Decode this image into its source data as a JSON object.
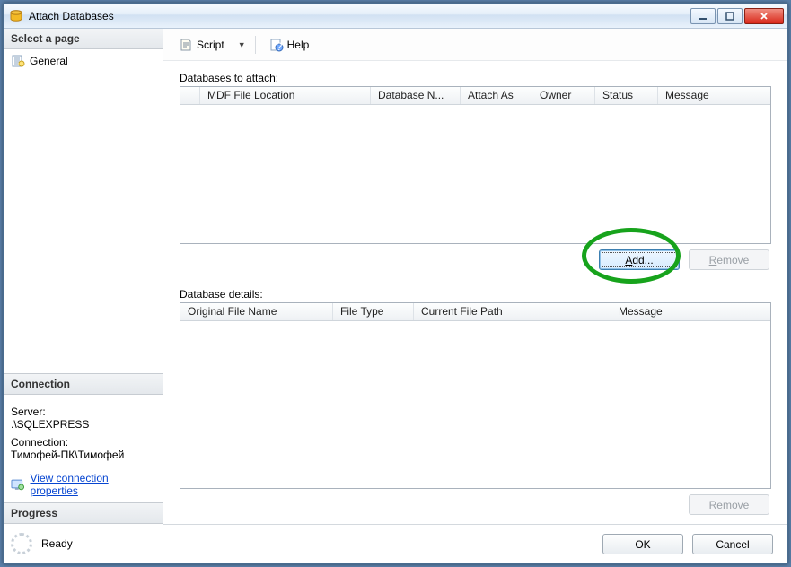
{
  "window": {
    "title": "Attach Databases"
  },
  "win_controls": {
    "minimize": "minimize",
    "maximize": "maximize",
    "close": "close"
  },
  "left": {
    "select_page_header": "Select a page",
    "pages": [
      {
        "label": "General"
      }
    ],
    "connection_header": "Connection",
    "server_label": "Server:",
    "server_value": ".\\SQLEXPRESS",
    "connection_label": "Connection:",
    "connection_value": "Тимофей-ПК\\Тимофей",
    "view_props_link": "View connection properties",
    "progress_header": "Progress",
    "progress_status": "Ready"
  },
  "toolbar": {
    "script_label": "Script",
    "help_label": "Help"
  },
  "attach_grid": {
    "label_html": "Databases to attach:",
    "label_u": "D",
    "label_rest": "atabases to attach:",
    "cols": {
      "mdf": "MDF File Location",
      "dbname": "Database N...",
      "attachas": "Attach As",
      "owner": "Owner",
      "status": "Status",
      "message": "Message"
    }
  },
  "buttons": {
    "add": "Add...",
    "remove_top": "Remove",
    "remove_bottom": "Remove",
    "ok": "OK",
    "cancel": "Cancel"
  },
  "details_grid": {
    "label": "Database details:",
    "cols": {
      "orig": "Original File Name",
      "type": "File Type",
      "path": "Current File Path",
      "message": "Message"
    }
  }
}
